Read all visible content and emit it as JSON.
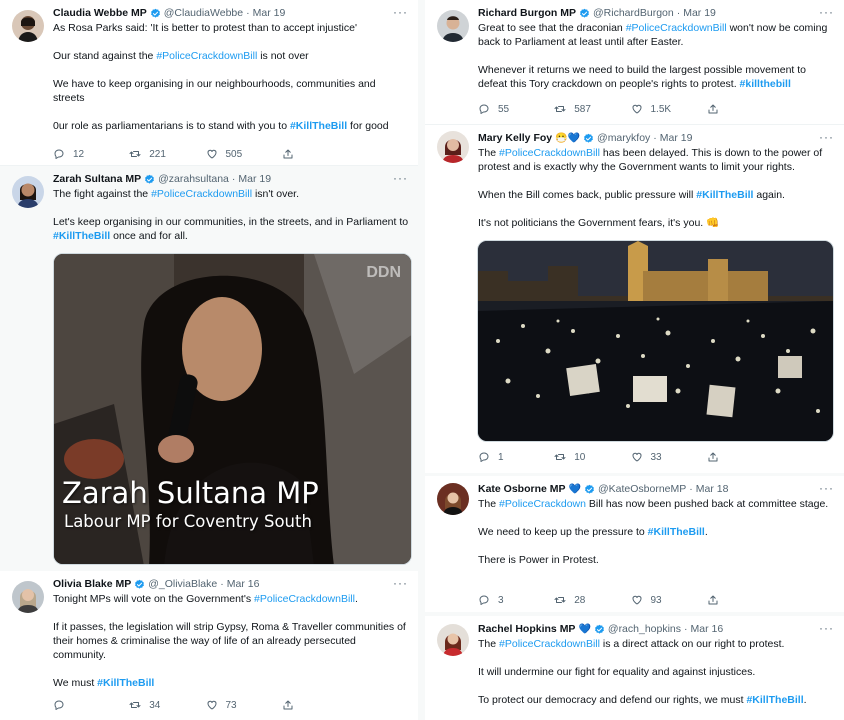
{
  "colors": {
    "accent": "#1d9bf0",
    "verified": "#1d9bf0",
    "muted": "#536471"
  },
  "left": [
    {
      "name": "Claudia Webbe MP",
      "handle": "@ClaudiaWebbe",
      "date": "Mar 19",
      "p1": "As Rosa Parks said: 'It is better to protest than to accept injustice'",
      "p2a": "Our stand against the ",
      "p2tag": "#PoliceCrackdownBill",
      "p2b": " is not over",
      "p3": "We have to keep organising in our neighbourhoods, communities and streets",
      "p4a": "0ur role as parliamentarians is to stand with you to ",
      "p4tag": "#KillTheBill",
      "p4b": " for good",
      "replies": "12",
      "retweets": "221",
      "likes": "505"
    },
    {
      "name": "Zarah Sultana MP",
      "handle": "@zarahsultana",
      "date": "Mar 19",
      "p1a": "The fight against the ",
      "p1tag": "#PoliceCrackdownBill",
      "p1b": " isn't over.",
      "p2a": "Let's keep organising in our communities, in the streets, and in Parliament to ",
      "p2tag": "#KillTheBill",
      "p2b": " once and for all.",
      "video_title": "Zarah Sultana MP",
      "video_subtitle": "Labour MP for Coventry South",
      "video_watermark": "DDN"
    },
    {
      "name": "Olivia Blake MP",
      "handle": "@_OliviaBlake",
      "date": "Mar 16",
      "p1a": "Tonight MPs will vote on the Government's ",
      "p1tag": "#PoliceCrackdownBill",
      "p1b": ".",
      "p2": "If it passes, the legislation will strip Gypsy, Roma & Traveller communities of their homes & criminalise the way of life of an already persecuted community.",
      "p3a": "We must ",
      "p3tag": "#KillTheBill",
      "replies": "",
      "retweets": "34",
      "likes": "73"
    }
  ],
  "right": [
    {
      "name": "Richard Burgon MP",
      "handle": "@RichardBurgon",
      "date": "Mar 19",
      "p1a": "Great to see that the draconian ",
      "p1tag": "#PoliceCrackdownBill",
      "p1b": " won't now be coming back to Parliament at least until after Easter.",
      "p2a": "Whenever it returns we need to build the largest possible movement to defeat this Tory crackdown on people's rights to protest. ",
      "p2tag": "#killthebill",
      "replies": "55",
      "retweets": "587",
      "likes": "1.5K"
    },
    {
      "name": "Mary Kelly Foy",
      "name_emoji": "😷💙",
      "handle": "@marykfoy",
      "date": "Mar 19",
      "p1a": "The ",
      "p1tag": "#PoliceCrackdownBill",
      "p1b": " has been delayed. This is down to the power of protest and is exactly why the Government wants to limit your rights.",
      "p2a": "When the Bill comes back, public pressure will ",
      "p2tag": "#KillTheBill",
      "p2b": " again.",
      "p3": "It's not politicians the Government fears, it's you. 👊",
      "replies": "1",
      "retweets": "10",
      "likes": "33"
    },
    {
      "name": "Kate Osborne MP",
      "name_emoji": "💙",
      "handle": "@KateOsborneMP",
      "date": "Mar 18",
      "p1a": "The ",
      "p1tag": "#PoliceCrackdown",
      "p1b": " Bill has now been pushed back at committee stage.",
      "p2a": "We need to keep up the pressure to ",
      "p2tag": "#KillTheBill",
      "p2b": ".",
      "p3": "There is Power in Protest.",
      "replies": "3",
      "retweets": "28",
      "likes": "93"
    },
    {
      "name": "Rachel Hopkins MP",
      "name_emoji": "💙",
      "handle": "@rach_hopkins",
      "date": "Mar 16",
      "p1a": "The ",
      "p1tag": "#PoliceCrackdownBill",
      "p1b": " is a direct attack on our right to protest.",
      "p2": "It will undermine our fight for equality and against injustices.",
      "p3a": "To protect our democracy and defend our rights, we must ",
      "p3tag": "#KillTheBill",
      "p3b": "."
    }
  ]
}
